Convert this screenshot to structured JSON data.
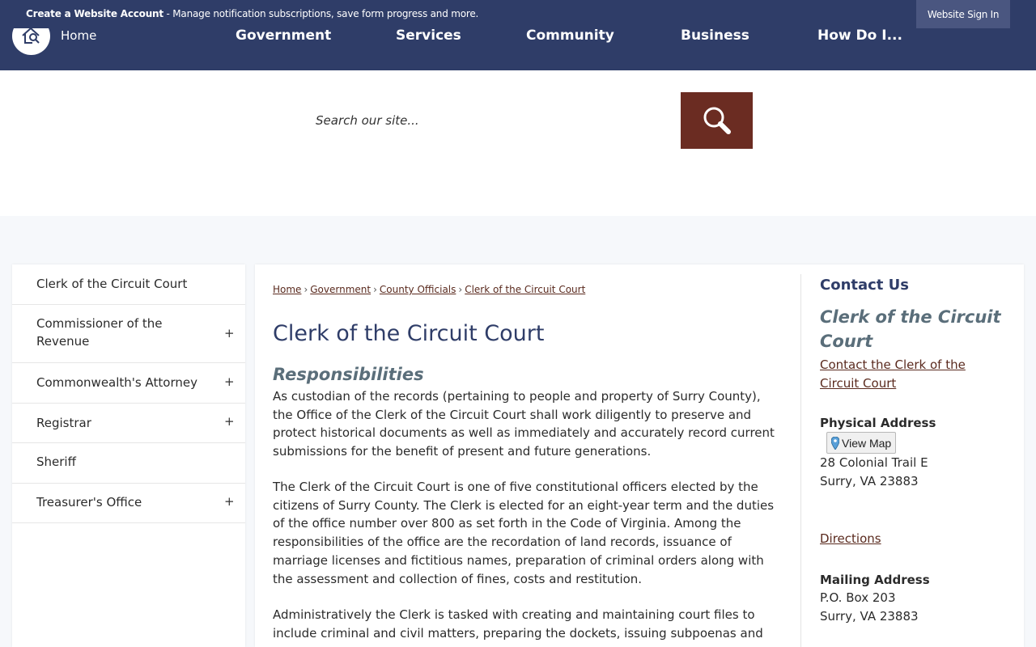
{
  "topbar": {
    "create_account_bold": "Create a Website Account",
    "create_account_rest": " - Manage notification subscriptions, save form progress and more.",
    "signin_label": "Website Sign In"
  },
  "nav": {
    "home_label": "Home",
    "items": [
      "Government",
      "Services",
      "Community",
      "Business",
      "How Do I..."
    ]
  },
  "search": {
    "placeholder": "Search our site..."
  },
  "sidebar": {
    "items": [
      {
        "label": "Clerk of the Circuit Court",
        "expand": ""
      },
      {
        "label": "Commissioner of the Revenue",
        "expand": "+"
      },
      {
        "label": "Commonwealth's Attorney",
        "expand": "+"
      },
      {
        "label": "Registrar",
        "expand": "+"
      },
      {
        "label": "Sheriff",
        "expand": ""
      },
      {
        "label": "Treasurer's Office",
        "expand": "+"
      }
    ]
  },
  "breadcrumb": [
    "Home",
    "Government",
    "County Officials",
    "Clerk of the Circuit Court"
  ],
  "breadcrumb_sep": "›",
  "main": {
    "title": "Clerk of the Circuit Court",
    "subhead": "Responsibilities",
    "paragraphs": [
      "As custodian of the records (pertaining to people and property of Surry County), the Office of the Clerk of the Circuit Court shall work diligently to preserve and protect historical documents as well as immediately and accurately record current submissions for the benefit of present and future generations.",
      "The Clerk of the Circuit Court is one of five constitutional officers elected by the citizens of Surry County. The Clerk is elected for an eight-year term and the duties of the office number over 800 as set forth in the Code of Virginia. Among the responsibilities of the office are the recordation of land records, issuance of marriage licenses and fictitious names, preparation of criminal orders along with the assessment and collection of fines, costs and restitution.",
      "Administratively the Clerk is tasked with creating and maintaining court files to include criminal and civil matters, preparing the dockets, issuing subpoenas and"
    ]
  },
  "contact": {
    "title": "Contact Us",
    "name": "Clerk of the Circuit Court",
    "contact_link": "Contact the Clerk of the Circuit Court",
    "physical_label": "Physical Address",
    "view_map": "View Map",
    "physical_line1": "28 Colonial Trail E",
    "physical_line2": "Surry, VA 23883",
    "directions": "Directions",
    "mailing_label": "Mailing Address",
    "mailing_line1": "P.O. Box 203",
    "mailing_line2": "Surry, VA 23883"
  },
  "colors": {
    "nav_bg": "#2f3d68",
    "search_button": "#6b2c22",
    "link": "#5a2a1e",
    "heading": "#2f3d68",
    "subhead": "#5a6e7a"
  }
}
